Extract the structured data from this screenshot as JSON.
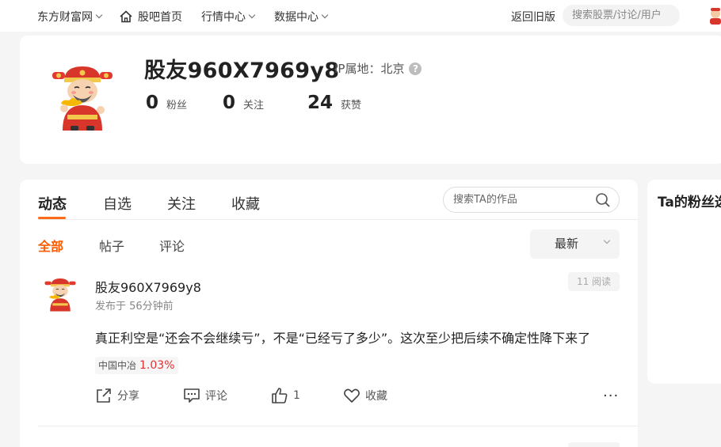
{
  "topbar": {
    "site": "东方财富网",
    "home": "股吧首页",
    "market": "行情中心",
    "data": "数据中心",
    "old_version": "返回旧版",
    "search_placeholder": "搜索股票/讨论/用户"
  },
  "profile": {
    "username": "股友960X7969y8",
    "ip_label": "IP属地：北京",
    "stats": [
      {
        "value": "0",
        "label": "粉丝"
      },
      {
        "value": "0",
        "label": "关注"
      },
      {
        "value": "24",
        "label": "获赞"
      }
    ]
  },
  "tabs": [
    "动态",
    "自选",
    "关注",
    "收藏"
  ],
  "works_search_placeholder": "搜索TA的作品",
  "subtabs": [
    "全部",
    "帖子",
    "评论"
  ],
  "sort": {
    "selected": "最新"
  },
  "post": {
    "author": "股友960X7969y8",
    "time": "发布于 56分钟前",
    "reads": "11 阅读",
    "content": "真正利空是“还会不会继续亏”，不是“已经亏了多少”。这次至少把后续不确定性降下来了",
    "stock_name": "中国中冶",
    "stock_change": "1.03%",
    "actions": {
      "share": "分享",
      "comment": "评论",
      "like_count": "1",
      "collect": "收藏"
    },
    "more": "···"
  },
  "right_card": {
    "title": "Ta的粉丝选"
  },
  "colors": {
    "accent": "#ff6a1a",
    "rise": "#e62f2f"
  }
}
